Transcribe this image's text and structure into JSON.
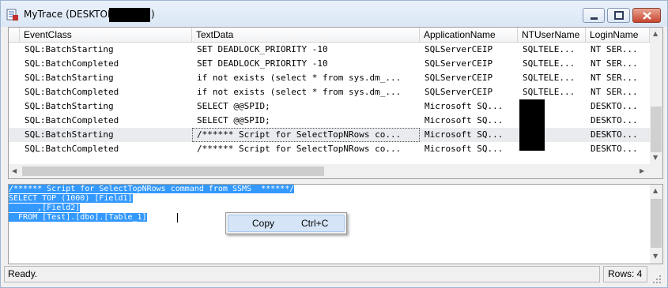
{
  "window": {
    "title": "MyTrace (DESKTOP-",
    "title_suffix": ")",
    "controls": [
      "minimize",
      "maximize",
      "close"
    ]
  },
  "grid": {
    "columns": [
      "EventClass",
      "TextData",
      "ApplicationName",
      "NTUserName",
      "LoginName"
    ],
    "rows": [
      [
        "SQL:BatchStarting",
        "SET DEADLOCK_PRIORITY -10",
        "SQLServerCEIP",
        "SQLTELE...",
        "NT SER..."
      ],
      [
        "SQL:BatchCompleted",
        "SET DEADLOCK_PRIORITY -10",
        "SQLServerCEIP",
        "SQLTELE...",
        "NT SER..."
      ],
      [
        "SQL:BatchStarting",
        "if not exists (select * from sys.dm_...",
        "SQLServerCEIP",
        "SQLTELE...",
        "NT SER..."
      ],
      [
        "SQL:BatchCompleted",
        "if not exists (select * from sys.dm_...",
        "SQLServerCEIP",
        "SQLTELE...",
        "NT SER..."
      ],
      [
        "SQL:BatchStarting",
        "SELECT @@SPID;",
        "Microsoft SQ...",
        "",
        "DESKTO..."
      ],
      [
        "SQL:BatchCompleted",
        "SELECT @@SPID;",
        "Microsoft SQ...",
        "",
        "DESKTO..."
      ],
      [
        "SQL:BatchStarting",
        "/****** Script for SelectTopNRows co...",
        "Microsoft SQ...",
        "",
        "DESKTO..."
      ],
      [
        "SQL:BatchCompleted",
        "/****** Script for SelectTopNRows co...",
        "Microsoft SQ...",
        "",
        "DESKTO..."
      ]
    ],
    "selected_row": 6
  },
  "text_pane": {
    "lines": [
      "/****** Script for SelectTopNRows command from SSMS  ******/",
      "SELECT TOP (1000) [Field1]",
      "      ,[Field2]",
      "  FROM [Test].[dbo].[Table_1]"
    ]
  },
  "context_menu": {
    "item_label": "Copy",
    "item_shortcut": "Ctrl+C"
  },
  "status": {
    "text": "Ready.",
    "rows": "Rows: 4"
  },
  "colors": {
    "selection": "#3399ff",
    "menu_highlight": "#d5e5f7",
    "titlebar": "#dbe7f5",
    "close_button": "#c8452d"
  }
}
